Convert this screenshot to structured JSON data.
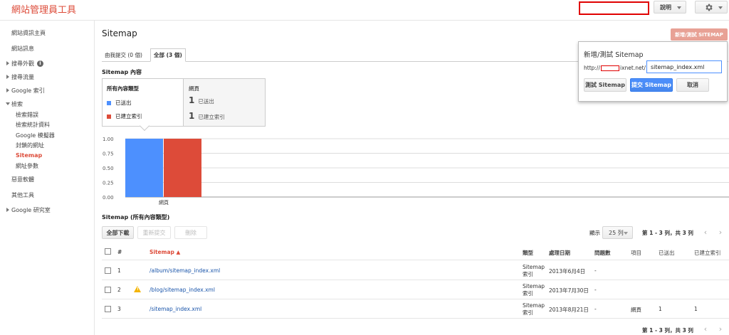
{
  "header": {
    "app_title": "網站管理員工具",
    "help_label": "說明",
    "settings_icon": "gear-icon"
  },
  "sidebar": {
    "items": [
      {
        "label": "網站資訊主頁"
      },
      {
        "label": "網站訊息"
      },
      {
        "label": "搜尋外觀"
      },
      {
        "label": "搜尋流量"
      },
      {
        "label": "Google 索引"
      },
      {
        "label": "檢索"
      },
      {
        "label": "惡意軟體"
      },
      {
        "label": "其他工具"
      },
      {
        "label": "Google 研究室"
      }
    ],
    "crawl_sub": [
      {
        "label": "檢索錯誤"
      },
      {
        "label": "檢索統計資料"
      },
      {
        "label": "Google 模擬器"
      },
      {
        "label": "封鎖的網址"
      },
      {
        "label": "Sitemap"
      },
      {
        "label": "網址參數"
      }
    ]
  },
  "main": {
    "page_title": "Sitemap",
    "add_button": "新增/測試 SITEMAP",
    "tabs": [
      {
        "label": "由我提交 (0 個)"
      },
      {
        "label": "全部 (3 個)"
      }
    ],
    "content_title": "Sitemap 內容",
    "stats": {
      "types_title": "所有內容類型",
      "legend_submitted": "已送出",
      "legend_indexed": "已建立索引",
      "web_title": "網頁",
      "submitted_count": "1",
      "submitted_label": "已送出",
      "indexed_count": "1",
      "indexed_label": "已建立索引"
    },
    "table_title": "Sitemap (所有內容類型)",
    "toolbar": {
      "download_all": "全部下載",
      "resubmit": "重新提交",
      "delete": "刪除",
      "show_label": "顯示",
      "rows_value": "25 列",
      "pager_text": "第 1 - 3 列，共 3 列"
    },
    "table": {
      "headers": {
        "num": "#",
        "sitemap": "Sitemap ▲",
        "type": "類型",
        "processed": "處理日期",
        "issues": "問題數",
        "item": "項目",
        "submitted": "已送出",
        "indexed": "已建立索引"
      },
      "rows": [
        {
          "num": "1",
          "path": "/album/sitemap_index.xml",
          "type": "Sitemap 索引",
          "date": "2013年6月4日",
          "issues": "-",
          "item": "",
          "submitted": "",
          "indexed": "",
          "warning": false
        },
        {
          "num": "2",
          "path": "/blog/sitemap_index.xml",
          "type": "Sitemap 索引",
          "date": "2013年7月30日",
          "issues": "-",
          "item": "",
          "submitted": "",
          "indexed": "",
          "warning": true
        },
        {
          "num": "3",
          "path": "/sitemap_index.xml",
          "type": "Sitemap 索引",
          "date": "2013年8月21日",
          "issues": "-",
          "item": "網頁",
          "submitted": "1",
          "indexed": "1",
          "warning": false
        }
      ]
    },
    "bottom_pager_text": "第 1 - 3 列，共 3 列"
  },
  "popup": {
    "title": "新增/測試 Sitemap",
    "url_prefix_start": "http://",
    "url_prefix_end": "ixnet.net/",
    "input_value": "sitemap_index.xml",
    "test_button": "測試 Sitemap",
    "submit_button": "提交 Sitemap",
    "cancel_button": "取消"
  },
  "chart_data": {
    "type": "bar",
    "categories": [
      "網頁"
    ],
    "series": [
      {
        "name": "已送出",
        "values": [
          1
        ],
        "color": "#4d90fe"
      },
      {
        "name": "已建立索引",
        "values": [
          1
        ],
        "color": "#dd4b39"
      }
    ],
    "yticks": [
      "1.00",
      "0.75",
      "0.50",
      "0.25",
      "0.00"
    ],
    "ylim": [
      0,
      1
    ],
    "grid": true
  },
  "colors": {
    "brand_red": "#dd4b39",
    "blue": "#4d90fe",
    "link": "#1a55aa"
  }
}
